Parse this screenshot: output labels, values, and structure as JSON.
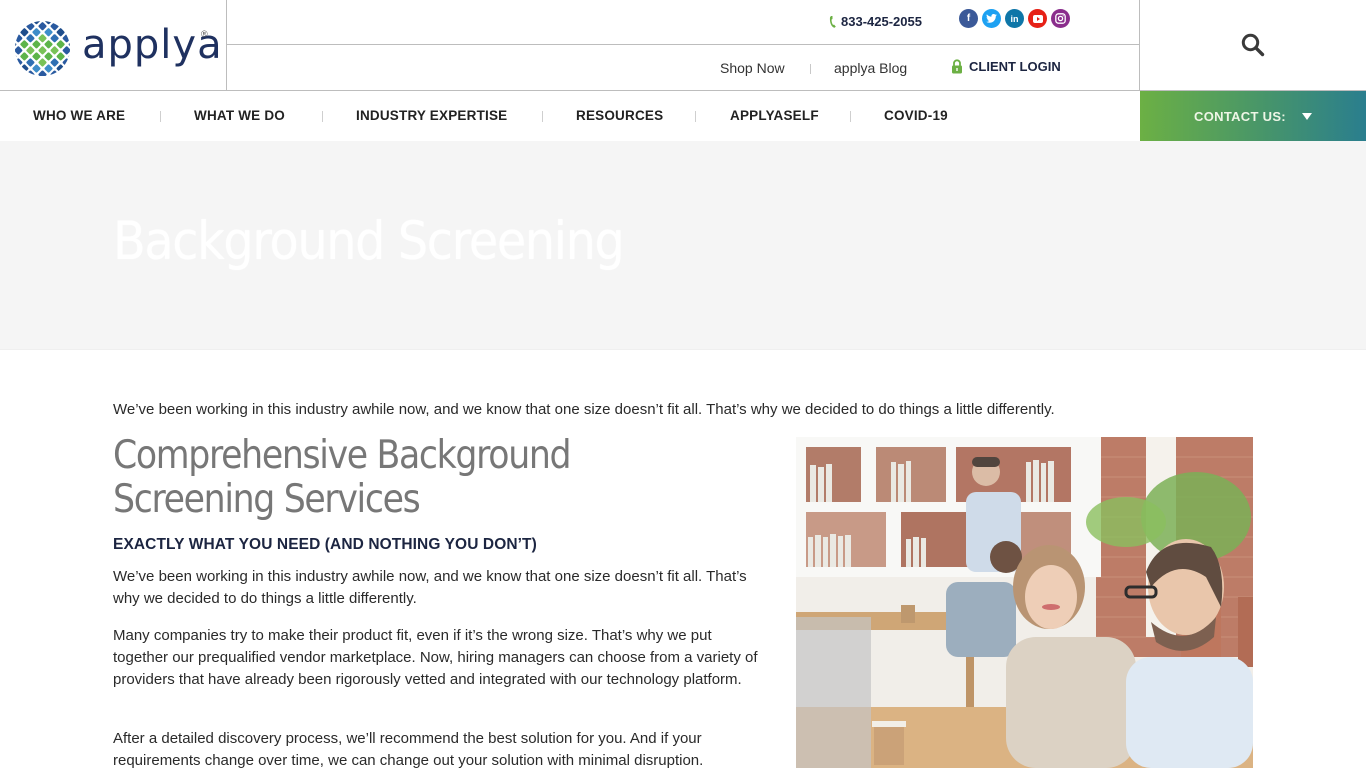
{
  "brand": {
    "name": "applya",
    "registered_mark": "®",
    "colors": {
      "navy": "#1c2541",
      "green": "#6cb044",
      "teal": "#2a7e8e",
      "hero_bg": "#f5f5f5"
    }
  },
  "topbar": {
    "phone": "833-425-2055",
    "phone_icon": "phone-icon",
    "socials": [
      {
        "name": "facebook",
        "glyph": "f"
      },
      {
        "name": "twitter",
        "glyph": "t"
      },
      {
        "name": "linkedin",
        "glyph": "in"
      },
      {
        "name": "youtube",
        "glyph": "▶"
      },
      {
        "name": "instagram",
        "glyph": "◎"
      }
    ]
  },
  "subbar": {
    "links": [
      "Shop Now",
      "applya Blog"
    ],
    "client_login": "CLIENT LOGIN",
    "lock_icon": "lock-icon"
  },
  "search": {
    "icon": "search-icon"
  },
  "nav": {
    "items": [
      "WHO WE ARE",
      "WHAT WE DO",
      "INDUSTRY EXPERTISE",
      "RESOURCES",
      "APPLYASELF",
      "COVID-19"
    ],
    "contact_label": "CONTACT US:",
    "contact_icon": "caret-down-icon"
  },
  "hero": {
    "title": "Background Screening"
  },
  "content": {
    "intro": "We’ve been working in this industry awhile now, and we know that one size doesn’t fit all. That’s why we decided to do things a little differently.",
    "section_title": "Comprehensive Background Screening Services",
    "section_subtitle": "EXACTLY WHAT YOU NEED (AND NOTHING YOU DON’T)",
    "paragraphs": [
      "We’ve been working in this industry awhile now, and we know that one size doesn’t fit all. That’s why we decided to do things a little differently.",
      "Many companies try to make their product fit, even if it’s the wrong size. That’s why we put together our prequalified vendor marketplace. Now, hiring managers can choose from a variety of providers that have already been rigorously vetted and integrated with our technology platform.",
      "After a detailed discovery process, we’ll recommend the best solution for you. And if your requirements change over time, we can change out your solution with minimal disruption."
    ],
    "photo_alt": "Coworkers collaborating at desks in a bright office"
  }
}
